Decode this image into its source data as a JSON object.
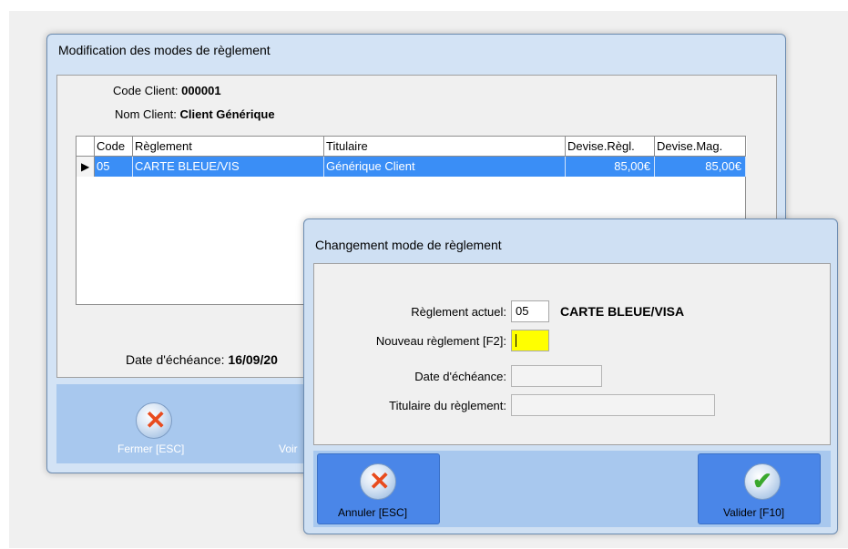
{
  "back_window": {
    "title": "Modification des modes de règlement",
    "code_client_label": "Code Client:",
    "code_client_value": "000001",
    "nom_client_label": "Nom Client:",
    "nom_client_value": "Client Générique",
    "grid": {
      "columns": [
        "Code",
        "Règlement",
        "Titulaire",
        "Devise.Règl.",
        "Devise.Mag."
      ],
      "rows": [
        {
          "code": "05",
          "reglement": "CARTE BLEUE/VIS",
          "titulaire": "Générique Client",
          "devise_regl": "85,00€",
          "devise_mag": "85,00€"
        }
      ]
    },
    "date_echeance_label": "Date d'échéance:",
    "date_echeance_value": "16/09/20",
    "close_button": "Fermer [ESC]",
    "view_button_partial": "Voir"
  },
  "dialog": {
    "title": "Changement mode de règlement",
    "reglement_actuel_label": "Règlement actuel:",
    "reglement_actuel_code": "05",
    "reglement_actuel_name": "CARTE BLEUE/VISA",
    "nouveau_reglement_label": "Nouveau règlement [F2]:",
    "nouveau_reglement_value": "",
    "date_echeance_label": "Date d'échéance:",
    "date_echeance_value": "",
    "titulaire_label": "Titulaire du règlement:",
    "titulaire_value": "",
    "cancel_button": "Annuler [ESC]",
    "ok_button": "Valider [F10]"
  },
  "colors": {
    "selection": "#3a8ef6",
    "button_bar": "#a8c8ee",
    "button_active": "#4a86e8",
    "focus_field": "#ffff00"
  },
  "icons": {
    "cancel": "cancel-icon",
    "ok": "checkmark-icon",
    "row_pointer": "row-pointer-icon"
  }
}
